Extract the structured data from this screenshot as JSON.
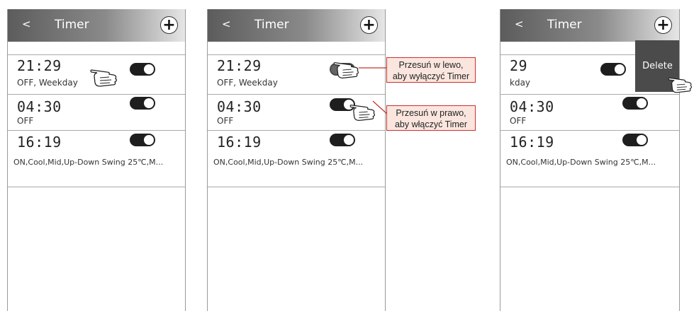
{
  "screens": [
    {
      "header": {
        "back": "<",
        "title": "Timer",
        "add": "+"
      },
      "timers": [
        {
          "time": "21:29",
          "detail": "OFF, Weekday",
          "enabled": true
        },
        {
          "time": "04:30",
          "detail": "OFF",
          "enabled": true
        },
        {
          "time": "16:19",
          "detail": "ON,Cool,Mid,Up-Down Swing 25℃,M...",
          "enabled": true
        }
      ]
    },
    {
      "header": {
        "back": "<",
        "title": "Timer",
        "add": "+"
      },
      "timers": [
        {
          "time": "21:29",
          "detail": "OFF, Weekday",
          "enabled": false
        },
        {
          "time": "04:30",
          "detail": "OFF",
          "enabled": true
        },
        {
          "time": "16:19",
          "detail": "ON,Cool,Mid,Up-Down Swing 25℃,M...",
          "enabled": true
        }
      ]
    },
    {
      "header": {
        "back": "<",
        "title": "Timer",
        "add": "+"
      },
      "timers": [
        {
          "time": "29",
          "detail": "kday",
          "enabled": true
        },
        {
          "time": "04:30",
          "detail": "OFF",
          "enabled": true
        },
        {
          "time": "16:19",
          "detail": "ON,Cool,Mid,Up-Down Swing 25℃,M...",
          "enabled": true
        }
      ],
      "delete_label": "Delete"
    }
  ],
  "callouts": {
    "swipe_left": [
      "Przesuń w lewo,",
      "aby wyłączyć Timer"
    ],
    "swipe_right": [
      "Przesuń w prawo,",
      "aby włączyć Timer"
    ]
  },
  "colors": {
    "header_dark": "#5c5c5c",
    "toggle": "#1e1e1e",
    "delete_bg": "#4b4b4b",
    "callout_bg": "#fbe6df",
    "callout_border": "#c9302c"
  }
}
